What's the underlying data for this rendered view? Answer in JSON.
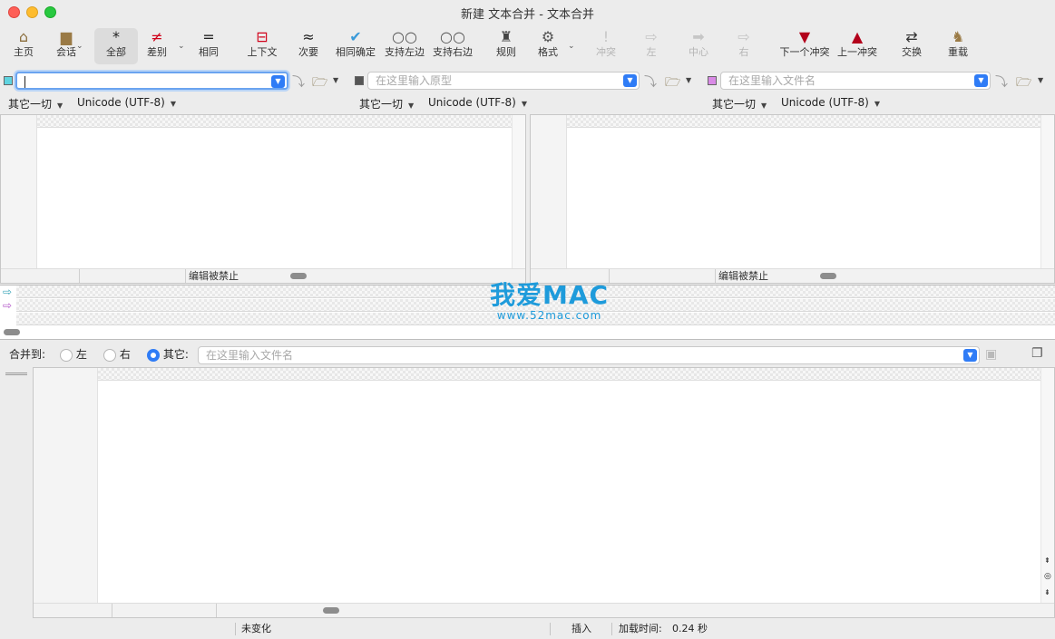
{
  "window": {
    "title": "新建 文本合并 - 文本合并"
  },
  "toolbar": {
    "items": [
      {
        "label": "主页",
        "icon": "home-icon",
        "glyph": "⌂",
        "color": "#8a6d3b"
      },
      {
        "label": "会话",
        "icon": "briefcase-icon",
        "glyph": "▆",
        "color": "#9a7a45"
      },
      {
        "label": "全部",
        "icon": "asterisk-icon",
        "glyph": "*",
        "color": "#222222"
      },
      {
        "label": "差别",
        "icon": "not-equal-icon",
        "glyph": "≠",
        "color": "#d0021b"
      },
      {
        "label": "相同",
        "icon": "equal-icon",
        "glyph": "=",
        "color": "#222222"
      },
      {
        "label": "上下文",
        "icon": "context-icon",
        "glyph": "⊟",
        "color": "#d0021b"
      },
      {
        "label": "次要",
        "icon": "approx-icon",
        "glyph": "≈",
        "color": "#222222"
      },
      {
        "label": "相同确定",
        "icon": "check-equal-icon",
        "glyph": "✔",
        "color": "#3a9ad9"
      },
      {
        "label": "支持左边",
        "icon": "align-left-icon",
        "glyph": "○○",
        "color": "#555555"
      },
      {
        "label": "支持右边",
        "icon": "align-right-icon",
        "glyph": "○○",
        "color": "#555555"
      },
      {
        "label": "规则",
        "icon": "person-icon",
        "glyph": "♜",
        "color": "#444444"
      },
      {
        "label": "格式",
        "icon": "format-gear-icon",
        "glyph": "⚙",
        "color": "#555555"
      },
      {
        "label": "冲突",
        "icon": "exclamation-icon",
        "glyph": "!",
        "color": "#c6c6c6"
      },
      {
        "label": "左",
        "icon": "left-arrow-icon",
        "glyph": "⇨",
        "color": "#c6c6c6"
      },
      {
        "label": "中心",
        "icon": "center-arrow-icon",
        "glyph": "➡",
        "color": "#c6c6c6"
      },
      {
        "label": "右",
        "icon": "right-arrow-icon",
        "glyph": "⇨",
        "color": "#c6c6c6"
      },
      {
        "label": "下一个冲突",
        "icon": "down-red-arrow-icon",
        "glyph": "▼",
        "color": "#b3001b"
      },
      {
        "label": "上一冲突",
        "icon": "up-red-arrow-icon",
        "glyph": "▲",
        "color": "#b3001b"
      },
      {
        "label": "交换",
        "icon": "swap-icon",
        "glyph": "⇄",
        "color": "#333333"
      },
      {
        "label": "重载",
        "icon": "reload-icon",
        "glyph": "♞",
        "color": "#9a7a45"
      }
    ]
  },
  "files": {
    "left": {
      "value": "",
      "placeholder": ""
    },
    "base": {
      "placeholder": "在这里输入原型"
    },
    "right": {
      "placeholder": "在这里输入文件名"
    }
  },
  "encoding": {
    "left": {
      "line_ending": "其它一切",
      "charset": "Unicode (UTF-8)"
    },
    "base": {
      "line_ending": "其它一切",
      "charset": "Unicode (UTF-8)"
    },
    "right": {
      "line_ending": "其它一切",
      "charset": "Unicode (UTF-8)"
    }
  },
  "panes": {
    "left_status": "编辑被禁止",
    "right_status": "编辑被禁止"
  },
  "watermark": {
    "title_cn": "我爱",
    "title_en": "MAC",
    "url": "www.52mac.com"
  },
  "merge": {
    "label": "合并到:",
    "left": "左",
    "right": "右",
    "other": "其它:",
    "selected": "其它",
    "placeholder": "在这里输入文件名"
  },
  "statusbar": {
    "change": "未变化",
    "mode": "插入",
    "load_time_label": "加载时间:",
    "load_time_value": "0.24 秒"
  },
  "colors": {
    "accent": "#2f7cf6",
    "left_marker": "#5fd4e0",
    "base_marker": "#555555",
    "right_marker": "#d98ae6"
  }
}
